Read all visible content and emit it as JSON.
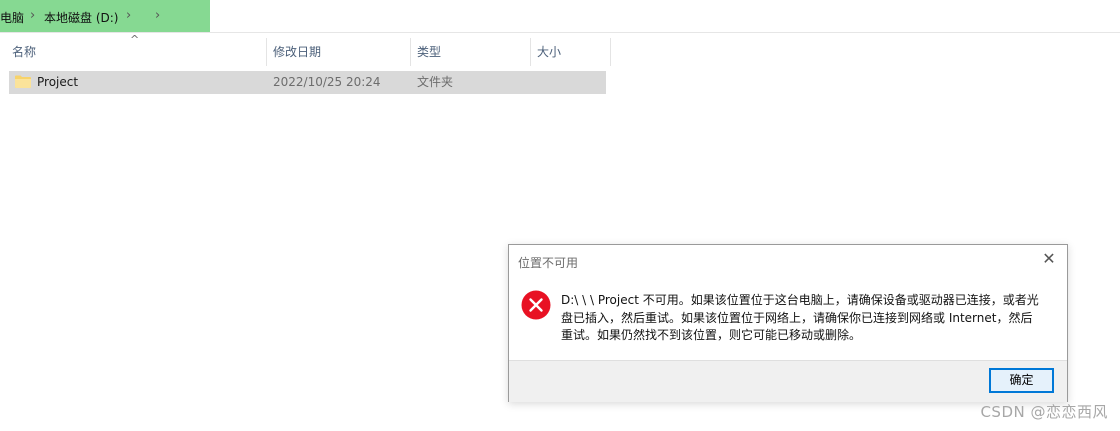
{
  "breadcrumb": {
    "items": [
      "电脑",
      "本地磁盘 (D:)"
    ],
    "separators": [
      "›",
      "›",
      "›"
    ]
  },
  "file_list": {
    "columns": [
      "名称",
      "修改日期",
      "类型",
      "大小"
    ],
    "sort_indicator": "^",
    "rows": [
      {
        "name": "Project",
        "modified": "2022/10/25 20:24",
        "type": "文件夹",
        "size": ""
      }
    ]
  },
  "dialog": {
    "title": "位置不可用",
    "message": "D:\\ \\ \\ Project  不可用。如果该位置位于这台电脑上，请确保设备或驱动器已连接，或者光盘已插入，然后重试。如果该位置位于网络上，请确保你已连接到网络或 Internet，然后重试。如果仍然找不到该位置，则它可能已移动或删除。",
    "ok_label": "确定",
    "close_glyph": "✕"
  },
  "watermark": "CSDN @恋恋西风",
  "colors": {
    "breadcrumb_highlight": "#86d992",
    "selected_row": "#d9d9d9",
    "error_icon": "#e81123",
    "ok_button_border": "#0078d7",
    "folder_icon": "#f7d36b"
  }
}
